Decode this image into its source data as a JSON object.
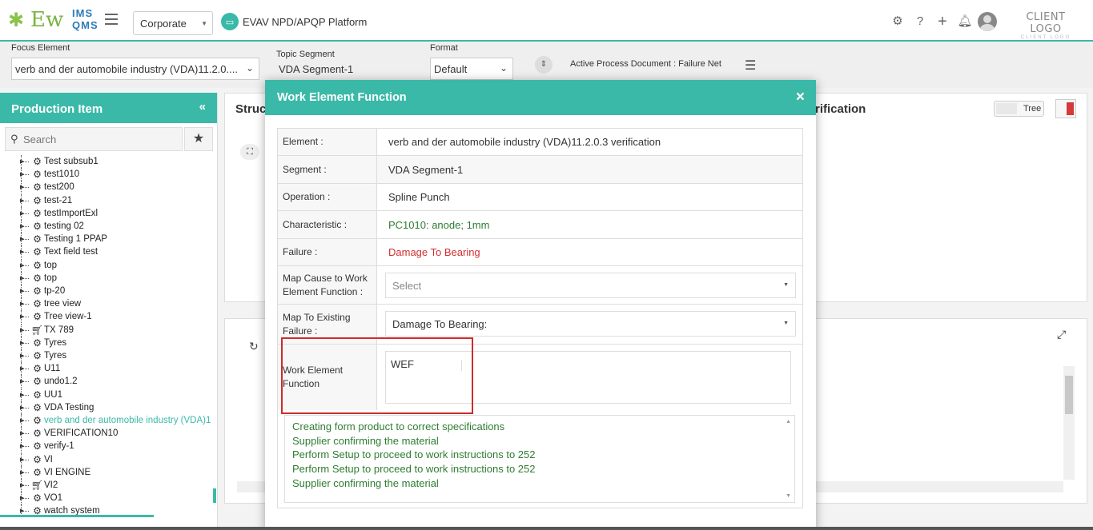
{
  "topbar": {
    "logo_main": "Ew",
    "logo_ims": "IMS",
    "logo_qms": "QMS",
    "org_select": "Corporate",
    "platform_name": "EVAV NPD/APQP Platform",
    "client_logo": "CLIENT LOGO",
    "client_logo_sub": "CLIENT LOGO",
    "icons": [
      "gear-icon",
      "help-icon",
      "plus-icon",
      "bell-icon",
      "user-avatar"
    ]
  },
  "filters": {
    "focus_label": "Focus Element",
    "focus_value": "verb and der automobile industry (VDA)11.2.0....",
    "topic_label": "Topic Segment",
    "topic_value": "VDA Segment-1",
    "format_label": "Format",
    "format_value": "Default",
    "active_doc": "Active Process Document : Failure Net"
  },
  "left_panel": {
    "title": "Production Item",
    "search_placeholder": "Search",
    "items": [
      {
        "label": "Test subsub1",
        "icon": "gear"
      },
      {
        "label": "test1010",
        "icon": "gear"
      },
      {
        "label": "test200",
        "icon": "gear"
      },
      {
        "label": "test-21",
        "icon": "gear"
      },
      {
        "label": "testImportExl",
        "icon": "gear"
      },
      {
        "label": "testing 02",
        "icon": "gear"
      },
      {
        "label": "Testing 1 PPAP",
        "icon": "gear"
      },
      {
        "label": "Text field test",
        "icon": "gear"
      },
      {
        "label": "top",
        "icon": "gear"
      },
      {
        "label": "top",
        "icon": "gear"
      },
      {
        "label": "tp-20",
        "icon": "gear"
      },
      {
        "label": "tree view",
        "icon": "gear"
      },
      {
        "label": "Tree view-1",
        "icon": "gear"
      },
      {
        "label": "TX 789",
        "icon": "cart"
      },
      {
        "label": "Tyres",
        "icon": "gear"
      },
      {
        "label": "Tyres",
        "icon": "gear"
      },
      {
        "label": "U11",
        "icon": "gear"
      },
      {
        "label": "undo1.2",
        "icon": "gear"
      },
      {
        "label": "UU1",
        "icon": "gear"
      },
      {
        "label": "VDA Testing",
        "icon": "gear"
      },
      {
        "label": "verb and der automobile industry (VDA)1",
        "icon": "gear",
        "active": true
      },
      {
        "label": "VERIFICATION10",
        "icon": "gear"
      },
      {
        "label": "verify-1",
        "icon": "gear"
      },
      {
        "label": "VI",
        "icon": "gear"
      },
      {
        "label": "VI ENGINE",
        "icon": "gear"
      },
      {
        "label": "VI2",
        "icon": "cart"
      },
      {
        "label": "VO1",
        "icon": "gear"
      },
      {
        "label": "watch system",
        "icon": "gear"
      }
    ]
  },
  "background": {
    "struct_title": "Struc",
    "verif_title": "rification",
    "tree_toggle": "Tree"
  },
  "modal": {
    "title": "Work Element Function",
    "rows": {
      "element_label": "Element :",
      "element_value": "verb and der automobile industry (VDA)11.2.0.3 verification",
      "segment_label": "Segment :",
      "segment_value": "VDA Segment-1",
      "operation_label": "Operation :",
      "operation_value": "Spline Punch",
      "characteristic_label": "Characteristic :",
      "characteristic_value": "PC1010: anode; 1mm",
      "failure_label": "Failure :",
      "failure_value": "Damage To Bearing",
      "map_cause_label": "Map Cause to Work Element Function :",
      "map_cause_placeholder": "Select",
      "map_existing_label": "Map To Existing Failure :",
      "map_existing_value": "Damage To Bearing:",
      "wef_label": "Work Element Function",
      "wef_value": "WEF"
    },
    "suggestions": [
      "Creating form product to correct specifications",
      "Supplier confirming the material",
      "Perform Setup to proceed to work instructions to 252",
      "Perform Setup to proceed to work instructions to 252",
      "Supplier confirming the material"
    ]
  },
  "colors": {
    "accent": "#3bb9a8",
    "green_text": "#2e7d32",
    "red_text": "#d32f2f",
    "highlight": "#cf2b2b"
  }
}
